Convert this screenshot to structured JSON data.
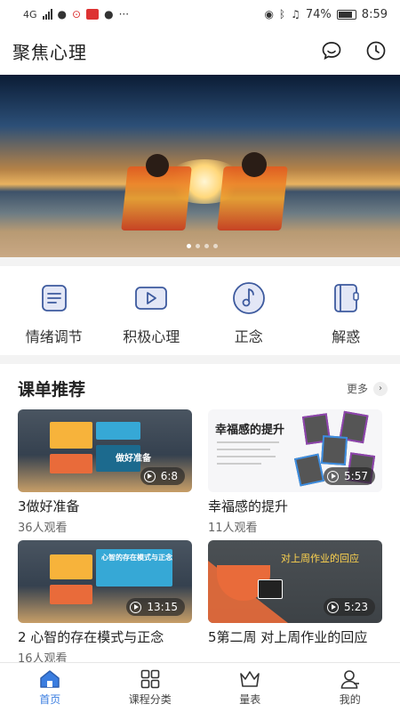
{
  "status_bar": {
    "network": "4G",
    "battery": "74%",
    "time": "8:59"
  },
  "header": {
    "title": "聚焦心理"
  },
  "categories": [
    {
      "label": "情绪调节",
      "icon": "document-list-icon"
    },
    {
      "label": "积极心理",
      "icon": "video-play-icon"
    },
    {
      "label": "正念",
      "icon": "music-note-icon"
    },
    {
      "label": "解惑",
      "icon": "notebook-icon"
    }
  ],
  "section": {
    "title": "课单推荐",
    "more_label": "更多"
  },
  "courses": [
    {
      "title": "3做好准备",
      "views": "36人观看",
      "duration": "6:8",
      "thumb_heading": "做好准备"
    },
    {
      "title": "幸福感的提升",
      "views": "11人观看",
      "duration": "5:57",
      "thumb_heading": "幸福感的提升"
    },
    {
      "title": "2 心智的存在模式与正念",
      "views": "16人观看",
      "duration": "13:15",
      "thumb_heading": "心智的存在模式与正念"
    },
    {
      "title": "5第二周 对上周作业的回应",
      "views": "",
      "duration": "5:23",
      "thumb_heading": "对上周作业的回应"
    }
  ],
  "nav": [
    {
      "label": "首页",
      "icon": "home-icon",
      "active": true
    },
    {
      "label": "课程分类",
      "icon": "grid-icon",
      "active": false
    },
    {
      "label": "量表",
      "icon": "crown-icon",
      "active": false
    },
    {
      "label": "我的",
      "icon": "profile-icon",
      "active": false
    }
  ],
  "colors": {
    "accent": "#3a7de0",
    "icon_blue": "#3d5a9e",
    "icon_fill": "#e3e7f6"
  }
}
